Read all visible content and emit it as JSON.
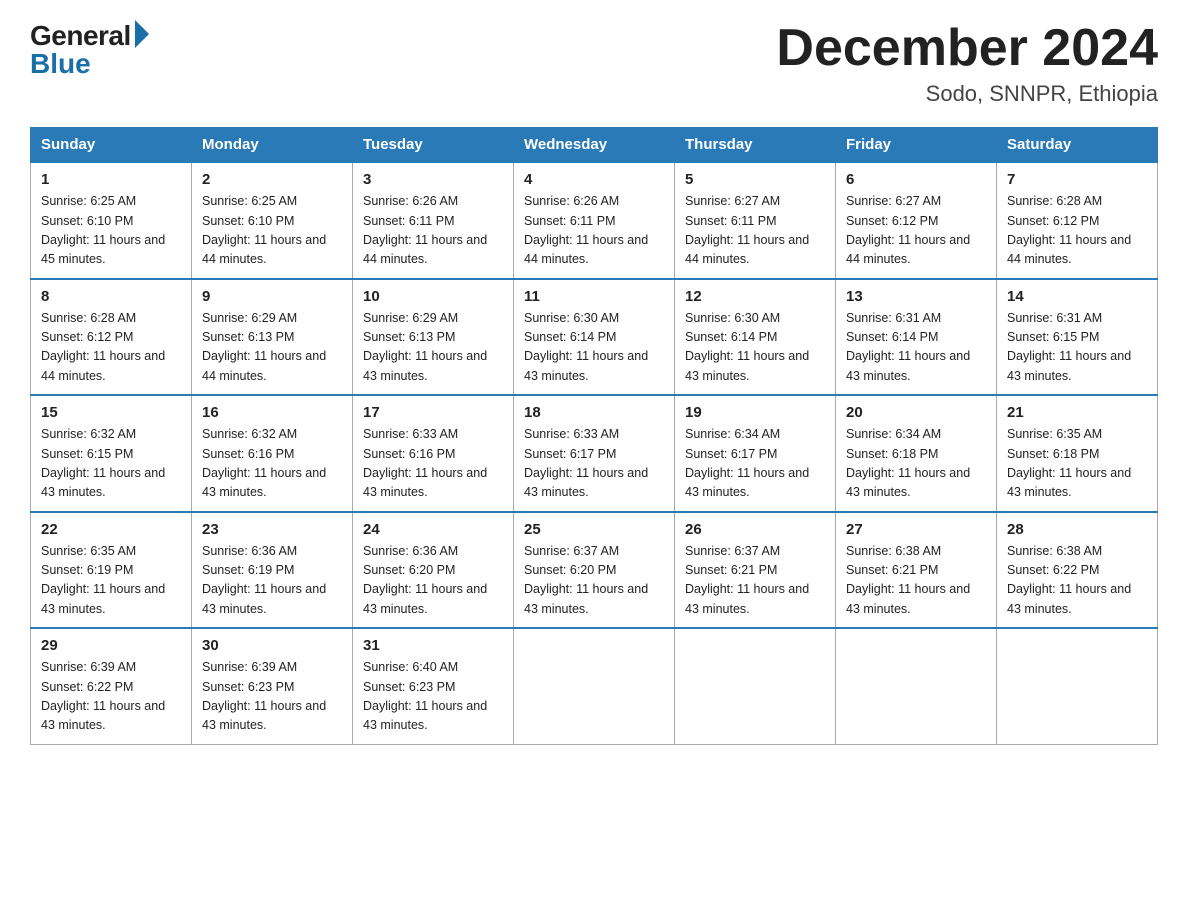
{
  "header": {
    "logo_general": "General",
    "logo_blue": "Blue",
    "month_title": "December 2024",
    "location": "Sodo, SNNPR, Ethiopia"
  },
  "weekdays": [
    "Sunday",
    "Monday",
    "Tuesday",
    "Wednesday",
    "Thursday",
    "Friday",
    "Saturday"
  ],
  "weeks": [
    [
      {
        "day": 1,
        "sunrise": "6:25 AM",
        "sunset": "6:10 PM",
        "daylight": "11 hours and 45 minutes."
      },
      {
        "day": 2,
        "sunrise": "6:25 AM",
        "sunset": "6:10 PM",
        "daylight": "11 hours and 44 minutes."
      },
      {
        "day": 3,
        "sunrise": "6:26 AM",
        "sunset": "6:11 PM",
        "daylight": "11 hours and 44 minutes."
      },
      {
        "day": 4,
        "sunrise": "6:26 AM",
        "sunset": "6:11 PM",
        "daylight": "11 hours and 44 minutes."
      },
      {
        "day": 5,
        "sunrise": "6:27 AM",
        "sunset": "6:11 PM",
        "daylight": "11 hours and 44 minutes."
      },
      {
        "day": 6,
        "sunrise": "6:27 AM",
        "sunset": "6:12 PM",
        "daylight": "11 hours and 44 minutes."
      },
      {
        "day": 7,
        "sunrise": "6:28 AM",
        "sunset": "6:12 PM",
        "daylight": "11 hours and 44 minutes."
      }
    ],
    [
      {
        "day": 8,
        "sunrise": "6:28 AM",
        "sunset": "6:12 PM",
        "daylight": "11 hours and 44 minutes."
      },
      {
        "day": 9,
        "sunrise": "6:29 AM",
        "sunset": "6:13 PM",
        "daylight": "11 hours and 44 minutes."
      },
      {
        "day": 10,
        "sunrise": "6:29 AM",
        "sunset": "6:13 PM",
        "daylight": "11 hours and 43 minutes."
      },
      {
        "day": 11,
        "sunrise": "6:30 AM",
        "sunset": "6:14 PM",
        "daylight": "11 hours and 43 minutes."
      },
      {
        "day": 12,
        "sunrise": "6:30 AM",
        "sunset": "6:14 PM",
        "daylight": "11 hours and 43 minutes."
      },
      {
        "day": 13,
        "sunrise": "6:31 AM",
        "sunset": "6:14 PM",
        "daylight": "11 hours and 43 minutes."
      },
      {
        "day": 14,
        "sunrise": "6:31 AM",
        "sunset": "6:15 PM",
        "daylight": "11 hours and 43 minutes."
      }
    ],
    [
      {
        "day": 15,
        "sunrise": "6:32 AM",
        "sunset": "6:15 PM",
        "daylight": "11 hours and 43 minutes."
      },
      {
        "day": 16,
        "sunrise": "6:32 AM",
        "sunset": "6:16 PM",
        "daylight": "11 hours and 43 minutes."
      },
      {
        "day": 17,
        "sunrise": "6:33 AM",
        "sunset": "6:16 PM",
        "daylight": "11 hours and 43 minutes."
      },
      {
        "day": 18,
        "sunrise": "6:33 AM",
        "sunset": "6:17 PM",
        "daylight": "11 hours and 43 minutes."
      },
      {
        "day": 19,
        "sunrise": "6:34 AM",
        "sunset": "6:17 PM",
        "daylight": "11 hours and 43 minutes."
      },
      {
        "day": 20,
        "sunrise": "6:34 AM",
        "sunset": "6:18 PM",
        "daylight": "11 hours and 43 minutes."
      },
      {
        "day": 21,
        "sunrise": "6:35 AM",
        "sunset": "6:18 PM",
        "daylight": "11 hours and 43 minutes."
      }
    ],
    [
      {
        "day": 22,
        "sunrise": "6:35 AM",
        "sunset": "6:19 PM",
        "daylight": "11 hours and 43 minutes."
      },
      {
        "day": 23,
        "sunrise": "6:36 AM",
        "sunset": "6:19 PM",
        "daylight": "11 hours and 43 minutes."
      },
      {
        "day": 24,
        "sunrise": "6:36 AM",
        "sunset": "6:20 PM",
        "daylight": "11 hours and 43 minutes."
      },
      {
        "day": 25,
        "sunrise": "6:37 AM",
        "sunset": "6:20 PM",
        "daylight": "11 hours and 43 minutes."
      },
      {
        "day": 26,
        "sunrise": "6:37 AM",
        "sunset": "6:21 PM",
        "daylight": "11 hours and 43 minutes."
      },
      {
        "day": 27,
        "sunrise": "6:38 AM",
        "sunset": "6:21 PM",
        "daylight": "11 hours and 43 minutes."
      },
      {
        "day": 28,
        "sunrise": "6:38 AM",
        "sunset": "6:22 PM",
        "daylight": "11 hours and 43 minutes."
      }
    ],
    [
      {
        "day": 29,
        "sunrise": "6:39 AM",
        "sunset": "6:22 PM",
        "daylight": "11 hours and 43 minutes."
      },
      {
        "day": 30,
        "sunrise": "6:39 AM",
        "sunset": "6:23 PM",
        "daylight": "11 hours and 43 minutes."
      },
      {
        "day": 31,
        "sunrise": "6:40 AM",
        "sunset": "6:23 PM",
        "daylight": "11 hours and 43 minutes."
      },
      null,
      null,
      null,
      null
    ]
  ]
}
